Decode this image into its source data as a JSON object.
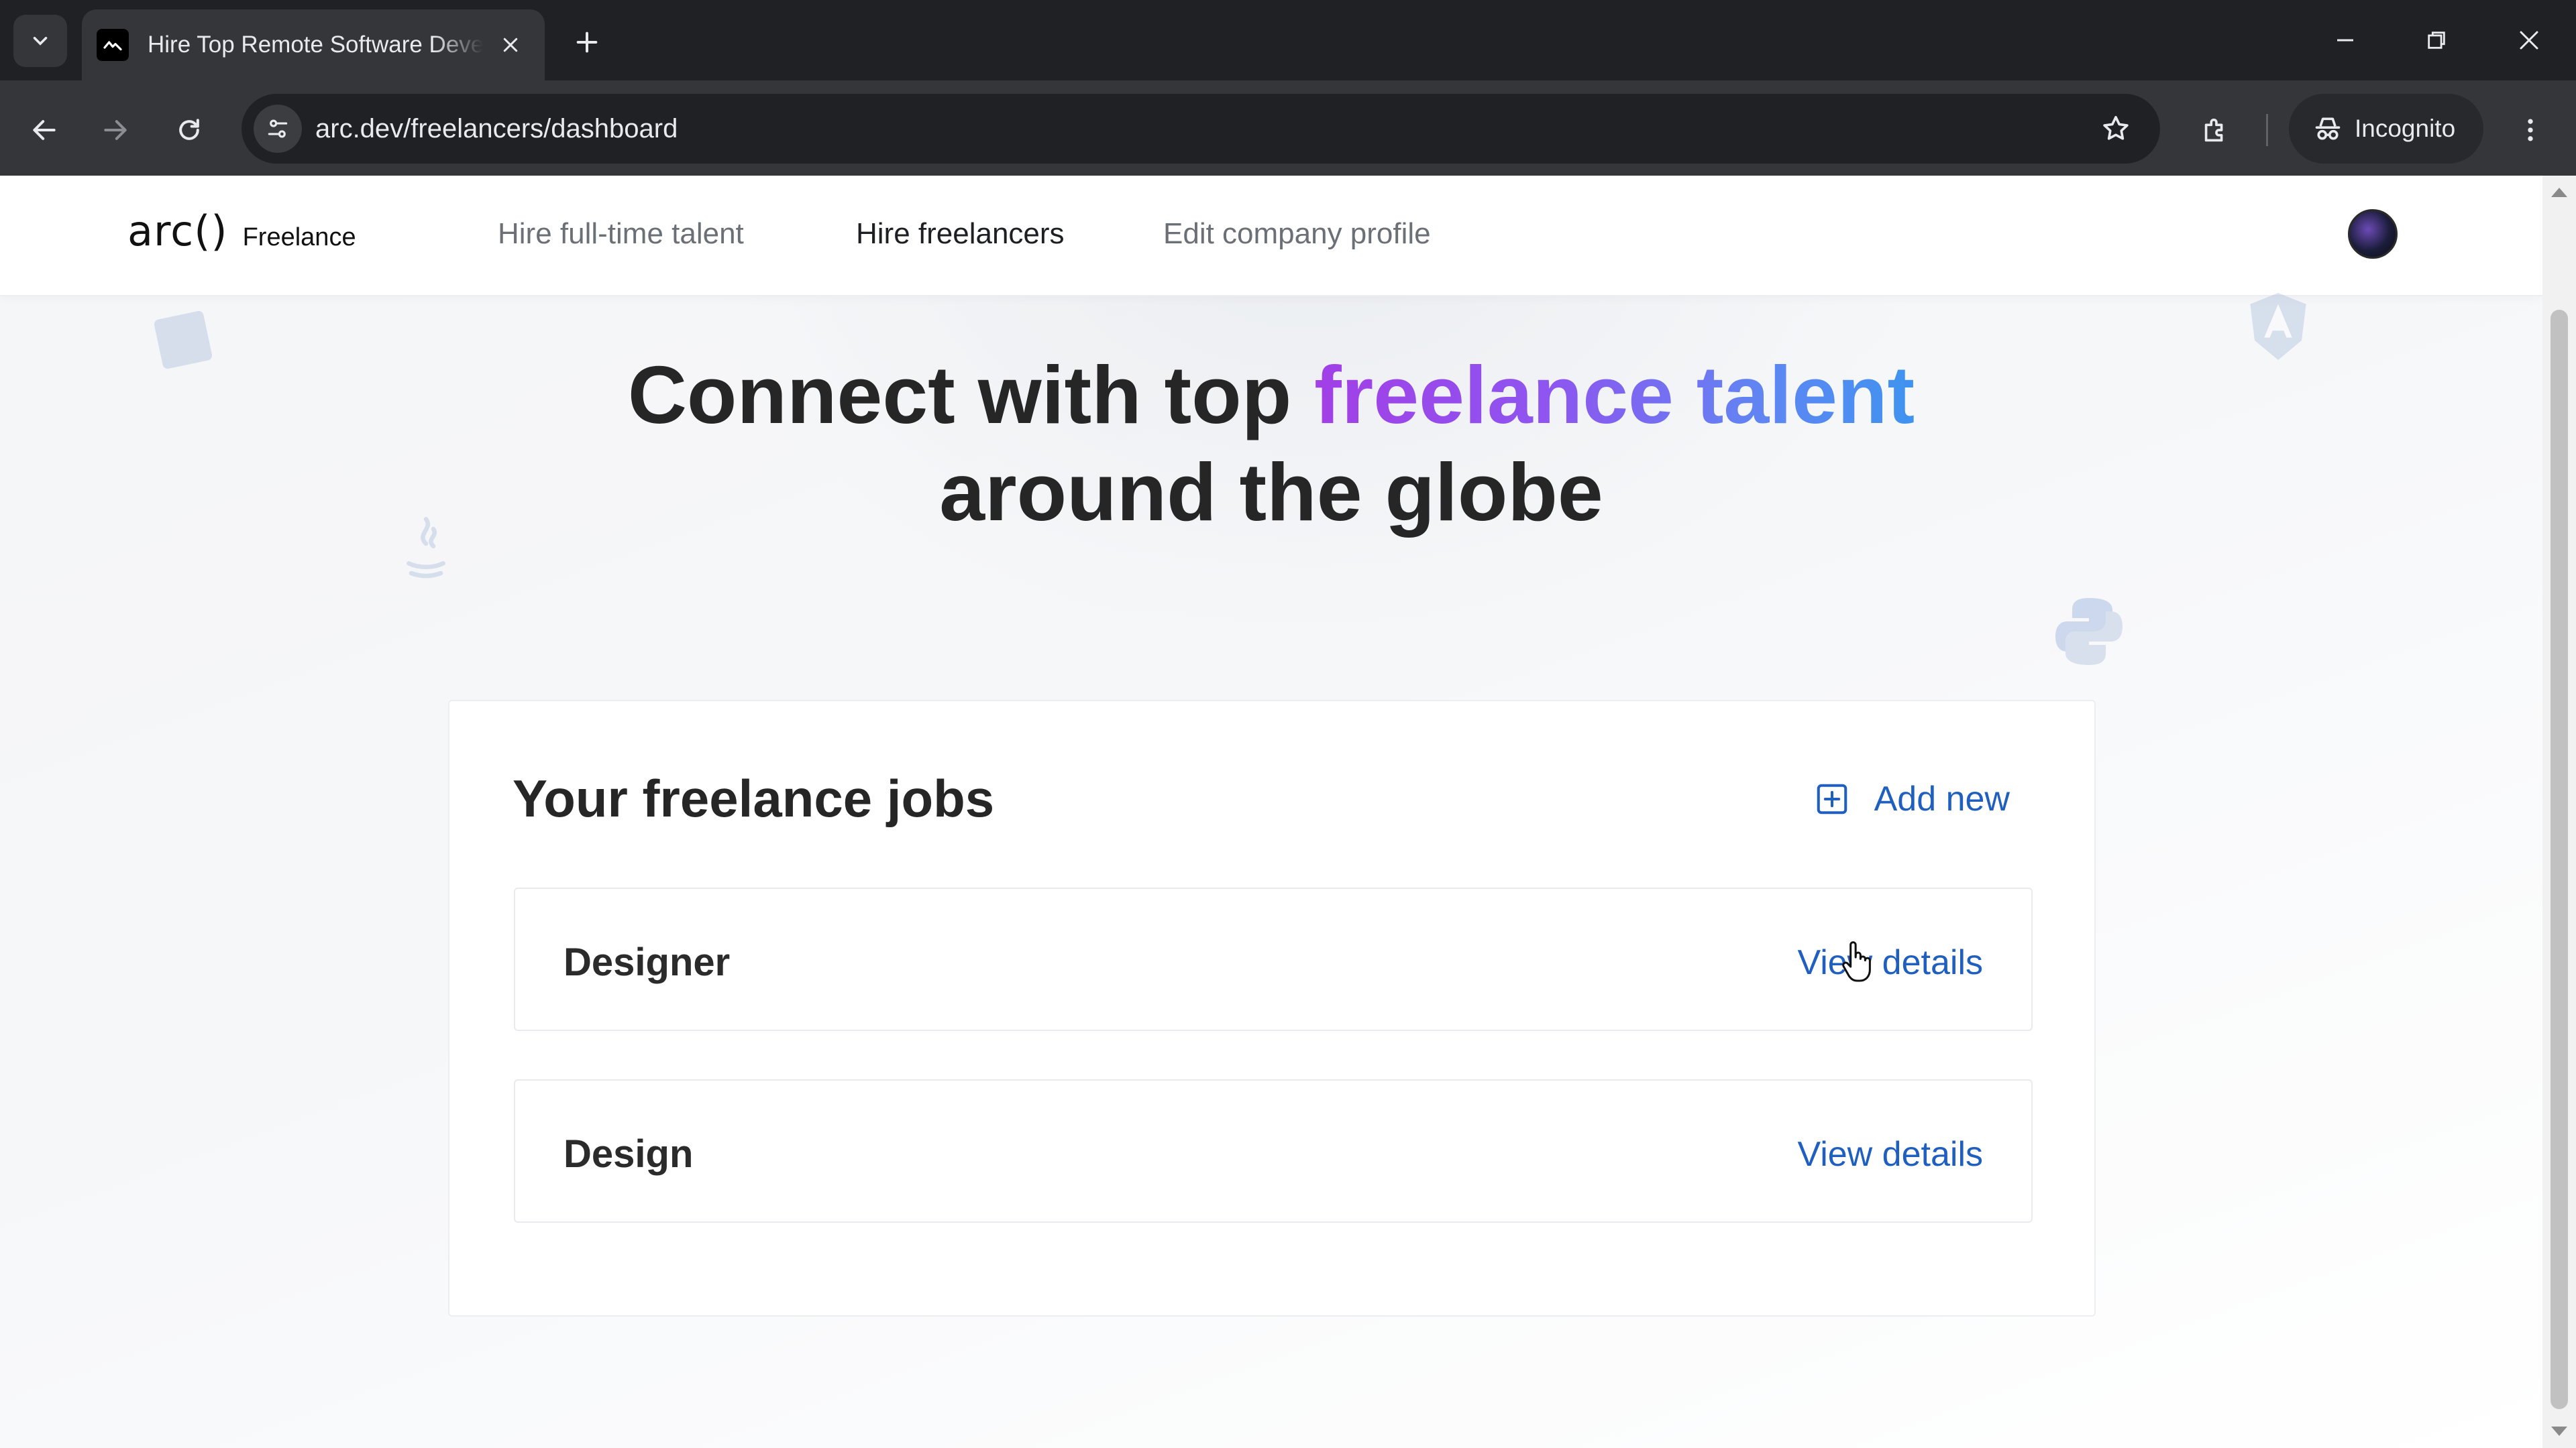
{
  "browser": {
    "tab_title": "Hire Top Remote Software Developers",
    "url": "arc.dev/freelancers/dashboard",
    "profile_label": "Incognito"
  },
  "site": {
    "logo_text": "arc()",
    "logo_sub": "Freelance",
    "nav": [
      {
        "label": "Hire full-time talent",
        "active": false
      },
      {
        "label": "Hire freelancers",
        "active": true
      },
      {
        "label": "Edit company profile",
        "active": false
      }
    ]
  },
  "hero": {
    "line1_prefix": "Connect with top ",
    "line1_highlight": "freelance talent",
    "line2": "around the globe"
  },
  "jobs": {
    "title": "Your freelance jobs",
    "add_new_label": "Add new",
    "items": [
      {
        "title": "Designer",
        "link_label": "View details"
      },
      {
        "title": "Design",
        "link_label": "View details"
      }
    ]
  },
  "icons": {
    "decorations": [
      "javascript-icon",
      "java-icon",
      "python-icon",
      "angular-icon"
    ]
  },
  "colors": {
    "link": "#1f5fbf",
    "gradient_start": "#a23fe6",
    "gradient_end": "#3f93f0",
    "chrome_dark": "#202124"
  }
}
